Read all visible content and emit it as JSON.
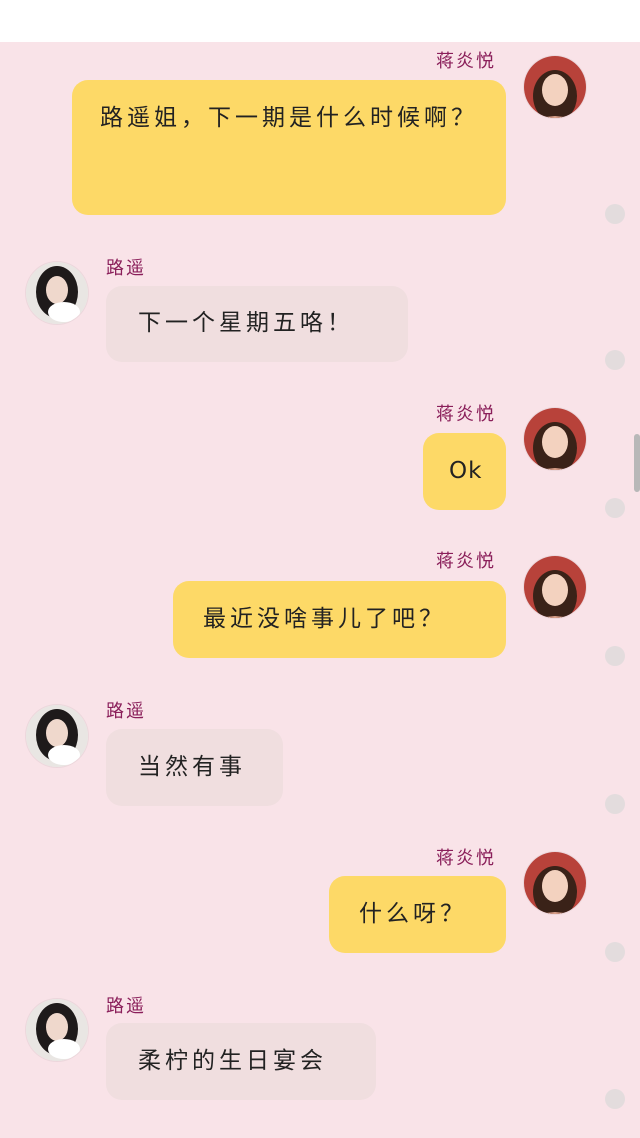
{
  "contacts": {
    "me": {
      "name": "蒋炎悦"
    },
    "other": {
      "name": "路遥"
    }
  },
  "messages": [
    {
      "sender": "me",
      "text": "路遥姐，下一期是什么时候啊？"
    },
    {
      "sender": "other",
      "text": "下一个星期五咯！"
    },
    {
      "sender": "me",
      "text": "Ok"
    },
    {
      "sender": "me",
      "text": "最近没啥事儿了吧？"
    },
    {
      "sender": "other",
      "text": "当然有事"
    },
    {
      "sender": "me",
      "text": "什么呀？"
    },
    {
      "sender": "other",
      "text": "柔柠的生日宴会"
    }
  ],
  "colors": {
    "background": "#f9e3e8",
    "my_bubble": "#fdd967",
    "other_bubble": "#f0dedf",
    "name_color": "#8a1f5a"
  }
}
